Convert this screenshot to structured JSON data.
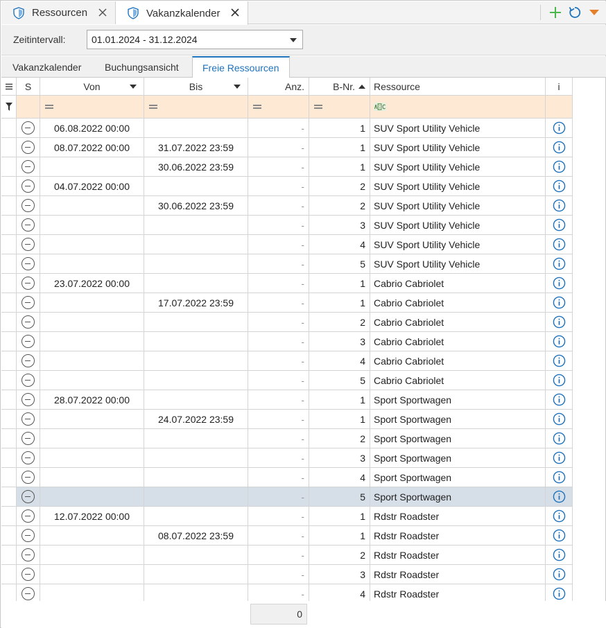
{
  "doc_tabs": [
    {
      "label": "Ressourcen",
      "icon": "shield-icon"
    },
    {
      "label": "Vakanzkalender",
      "icon": "shield-icon"
    }
  ],
  "toolbar": {
    "add_icon": "plus-icon",
    "refresh_icon": "refresh-icon",
    "menu_icon": "dropdown-triangle-icon"
  },
  "interval": {
    "label": "Zeitintervall:",
    "value": "01.01.2024 - 31.12.2024"
  },
  "view_tabs": [
    {
      "label": "Vakanzkalender",
      "active": false
    },
    {
      "label": "Buchungsansicht",
      "active": false
    },
    {
      "label": "Freie Ressourcen",
      "active": true
    }
  ],
  "columns": {
    "s": "S",
    "von": "Von",
    "bis": "Bis",
    "anz": "Anz.",
    "bnr": "B-Nr.",
    "res": "Ressource",
    "i": "i"
  },
  "rows": [
    {
      "von": "06.08.2022 00:00",
      "bis": "",
      "anz": "-",
      "bnr": "1",
      "res": "SUV Sport Utility Vehicle"
    },
    {
      "von": "08.07.2022 00:00",
      "bis": "31.07.2022 23:59",
      "anz": "-",
      "bnr": "1",
      "res": "SUV Sport Utility Vehicle"
    },
    {
      "von": "",
      "bis": "30.06.2022 23:59",
      "anz": "-",
      "bnr": "1",
      "res": "SUV Sport Utility Vehicle"
    },
    {
      "von": "04.07.2022 00:00",
      "bis": "",
      "anz": "-",
      "bnr": "2",
      "res": "SUV Sport Utility Vehicle"
    },
    {
      "von": "",
      "bis": "30.06.2022 23:59",
      "anz": "-",
      "bnr": "2",
      "res": "SUV Sport Utility Vehicle"
    },
    {
      "von": "",
      "bis": "",
      "anz": "-",
      "bnr": "3",
      "res": "SUV Sport Utility Vehicle"
    },
    {
      "von": "",
      "bis": "",
      "anz": "-",
      "bnr": "4",
      "res": "SUV Sport Utility Vehicle"
    },
    {
      "von": "",
      "bis": "",
      "anz": "-",
      "bnr": "5",
      "res": "SUV Sport Utility Vehicle"
    },
    {
      "von": "23.07.2022 00:00",
      "bis": "",
      "anz": "-",
      "bnr": "1",
      "res": "Cabrio Cabriolet"
    },
    {
      "von": "",
      "bis": "17.07.2022 23:59",
      "anz": "-",
      "bnr": "1",
      "res": "Cabrio Cabriolet"
    },
    {
      "von": "",
      "bis": "",
      "anz": "-",
      "bnr": "2",
      "res": "Cabrio Cabriolet"
    },
    {
      "von": "",
      "bis": "",
      "anz": "-",
      "bnr": "3",
      "res": "Cabrio Cabriolet"
    },
    {
      "von": "",
      "bis": "",
      "anz": "-",
      "bnr": "4",
      "res": "Cabrio Cabriolet"
    },
    {
      "von": "",
      "bis": "",
      "anz": "-",
      "bnr": "5",
      "res": "Cabrio Cabriolet"
    },
    {
      "von": "28.07.2022 00:00",
      "bis": "",
      "anz": "-",
      "bnr": "1",
      "res": "Sport Sportwagen"
    },
    {
      "von": "",
      "bis": "24.07.2022 23:59",
      "anz": "-",
      "bnr": "1",
      "res": "Sport Sportwagen"
    },
    {
      "von": "",
      "bis": "",
      "anz": "-",
      "bnr": "2",
      "res": "Sport Sportwagen"
    },
    {
      "von": "",
      "bis": "",
      "anz": "-",
      "bnr": "3",
      "res": "Sport Sportwagen"
    },
    {
      "von": "",
      "bis": "",
      "anz": "-",
      "bnr": "4",
      "res": "Sport Sportwagen"
    },
    {
      "von": "",
      "bis": "",
      "anz": "-",
      "bnr": "5",
      "res": "Sport Sportwagen",
      "selected": true
    },
    {
      "von": "12.07.2022 00:00",
      "bis": "",
      "anz": "-",
      "bnr": "1",
      "res": "Rdstr Roadster"
    },
    {
      "von": "",
      "bis": "08.07.2022 23:59",
      "anz": "-",
      "bnr": "1",
      "res": "Rdstr Roadster"
    },
    {
      "von": "",
      "bis": "",
      "anz": "-",
      "bnr": "2",
      "res": "Rdstr Roadster"
    },
    {
      "von": "",
      "bis": "",
      "anz": "-",
      "bnr": "3",
      "res": "Rdstr Roadster"
    },
    {
      "von": "",
      "bis": "",
      "anz": "-",
      "bnr": "4",
      "res": "Rdstr Roadster"
    }
  ],
  "footer": {
    "sum": "0"
  },
  "colors": {
    "accent": "#1e72bd",
    "filter_bg": "#fde9d4",
    "selected_row": "#d6dfe8",
    "add_green": "#4cb84c",
    "menu_orange": "#e5802a"
  }
}
